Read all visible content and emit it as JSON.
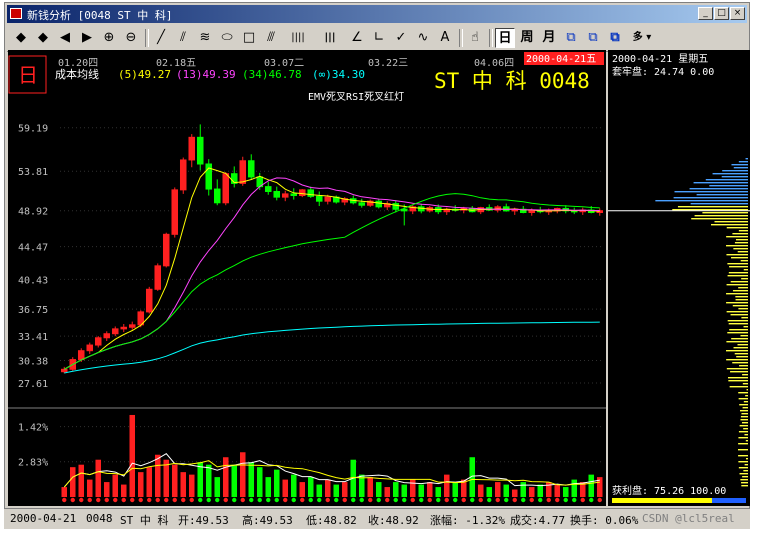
{
  "window": {
    "title": "新钱分析 [0048 ST 中 科]",
    "min": "_",
    "max": "□",
    "close": "×"
  },
  "toolbar": {
    "buttons": [
      {
        "name": "up-arrow-icon",
        "glyph": "◆"
      },
      {
        "name": "down-arrow-icon",
        "glyph": "◆"
      },
      {
        "name": "left-arrow-icon",
        "glyph": "◀"
      },
      {
        "name": "right-arrow-icon",
        "glyph": "▶"
      },
      {
        "name": "zoom-in-icon",
        "glyph": "⊕"
      },
      {
        "name": "zoom-out-icon",
        "glyph": "⊖"
      },
      {
        "name": "sep"
      },
      {
        "name": "line-tool-icon",
        "glyph": "╱"
      },
      {
        "name": "parallel-line-icon",
        "glyph": "⫽"
      },
      {
        "name": "fib-fan-icon",
        "glyph": "≋"
      },
      {
        "name": "ellipse-tool-icon",
        "glyph": "⬭"
      },
      {
        "name": "rect-tool-icon",
        "glyph": "□"
      },
      {
        "name": "channel-tool-icon",
        "glyph": "⫻"
      },
      {
        "name": "bars-tool-icon",
        "glyph": "||||"
      },
      {
        "name": "period-lines-icon",
        "glyph": "|||"
      },
      {
        "name": "angle-tool-icon",
        "glyph": "∠"
      },
      {
        "name": "speed-line-icon",
        "glyph": "∟"
      },
      {
        "name": "check-tool-icon",
        "glyph": "✓"
      },
      {
        "name": "wave-tool-icon",
        "glyph": "∿"
      },
      {
        "name": "text-tool-icon",
        "glyph": "A"
      },
      {
        "name": "sep"
      },
      {
        "name": "pointer-icon",
        "glyph": "☝"
      },
      {
        "name": "sep"
      },
      {
        "name": "period-day",
        "glyph": "日"
      },
      {
        "name": "period-week",
        "glyph": "周"
      },
      {
        "name": "period-month",
        "glyph": "月"
      },
      {
        "name": "window-tile-icon",
        "glyph": "⧉"
      },
      {
        "name": "window-cascade-icon",
        "glyph": "⧉"
      },
      {
        "name": "window-multi-icon",
        "glyph": "⧉"
      },
      {
        "name": "multi-dropdown",
        "glyph": "多 ▾"
      }
    ]
  },
  "chart": {
    "period_badge": "日",
    "ma_title": "成本均线",
    "ma_values": [
      {
        "label": "(5)49.27",
        "color": "#ffff00"
      },
      {
        "label": "(13)49.39",
        "color": "#ff44ff"
      },
      {
        "label": "(34)46.78",
        "color": "#00ff00"
      },
      {
        "label": "(∞)34.30",
        "color": "#00ffff"
      }
    ],
    "signal_text": "EMV死叉RSI死叉红灯",
    "stock_title": "ST 中 科 0048",
    "current_date_badge": "2000-04-21五",
    "date_labels": [
      "01.20四",
      "02.18五",
      "03.07二",
      "03.22三",
      "04.06四"
    ],
    "price_ticks": [
      "59.19",
      "53.81",
      "48.92",
      "44.47",
      "40.43",
      "36.75",
      "33.41",
      "30.38",
      "27.61"
    ],
    "volume_ticks": [
      "2.83%",
      "1.42%"
    ]
  },
  "chart_data": {
    "type": "candlestick",
    "title": "ST 中 科 0048",
    "ylabel": "",
    "ylim": [
      25.5,
      62
    ],
    "candles": [
      [
        29.0,
        29.6,
        28.8,
        29.3
      ],
      [
        29.3,
        30.8,
        29.1,
        30.5
      ],
      [
        30.5,
        31.9,
        30.2,
        31.6
      ],
      [
        31.6,
        32.6,
        31.2,
        32.3
      ],
      [
        32.3,
        33.4,
        32.0,
        33.2
      ],
      [
        33.2,
        34.0,
        32.8,
        33.7
      ],
      [
        33.7,
        34.6,
        33.4,
        34.3
      ],
      [
        34.3,
        34.9,
        33.9,
        34.5
      ],
      [
        34.5,
        35.2,
        34.2,
        34.8
      ],
      [
        34.8,
        36.6,
        34.5,
        36.4
      ],
      [
        36.4,
        39.5,
        36.2,
        39.2
      ],
      [
        39.2,
        42.4,
        39.0,
        42.1
      ],
      [
        42.1,
        46.2,
        41.9,
        46.0
      ],
      [
        46.0,
        51.8,
        45.6,
        51.5
      ],
      [
        51.5,
        55.5,
        51.0,
        55.2
      ],
      [
        55.2,
        58.4,
        54.3,
        58.0
      ],
      [
        58.0,
        59.6,
        53.9,
        54.7
      ],
      [
        54.7,
        55.3,
        50.8,
        51.6
      ],
      [
        51.6,
        52.8,
        49.6,
        49.9
      ],
      [
        49.9,
        53.7,
        49.6,
        53.5
      ],
      [
        53.5,
        54.4,
        51.8,
        52.3
      ],
      [
        52.3,
        55.6,
        52.0,
        55.1
      ],
      [
        55.1,
        55.9,
        52.8,
        53.1
      ],
      [
        53.1,
        53.6,
        51.5,
        51.9
      ],
      [
        51.9,
        52.5,
        50.9,
        51.3
      ],
      [
        51.3,
        51.9,
        50.2,
        50.6
      ],
      [
        50.6,
        51.4,
        50.1,
        51.0
      ],
      [
        51.0,
        51.7,
        50.3,
        50.8
      ],
      [
        50.8,
        51.6,
        50.6,
        51.5
      ],
      [
        51.5,
        51.9,
        50.5,
        50.7
      ],
      [
        50.7,
        51.3,
        49.5,
        50.1
      ],
      [
        50.1,
        50.9,
        49.7,
        50.6
      ],
      [
        50.6,
        50.8,
        49.8,
        50.0
      ],
      [
        50.0,
        50.6,
        49.6,
        50.4
      ],
      [
        50.4,
        50.8,
        49.7,
        49.9
      ],
      [
        49.9,
        50.4,
        49.3,
        49.6
      ],
      [
        49.6,
        50.3,
        49.4,
        50.1
      ],
      [
        50.1,
        50.4,
        49.2,
        49.4
      ],
      [
        49.4,
        50.1,
        49.0,
        49.8
      ],
      [
        49.8,
        50.2,
        48.7,
        49.1
      ],
      [
        49.1,
        49.7,
        47.1,
        48.9
      ],
      [
        48.9,
        49.6,
        48.5,
        49.4
      ],
      [
        49.4,
        49.8,
        48.6,
        48.9
      ],
      [
        48.9,
        49.5,
        48.7,
        49.3
      ],
      [
        49.3,
        49.7,
        48.5,
        48.8
      ],
      [
        48.8,
        49.3,
        48.4,
        49.1
      ],
      [
        49.1,
        49.6,
        48.8,
        49.0
      ],
      [
        49.0,
        49.4,
        48.6,
        49.2
      ],
      [
        49.2,
        49.5,
        48.7,
        48.8
      ],
      [
        48.8,
        49.4,
        48.5,
        49.3
      ],
      [
        49.3,
        49.7,
        48.9,
        49.0
      ],
      [
        49.0,
        49.6,
        48.7,
        49.4
      ],
      [
        49.4,
        49.8,
        48.8,
        48.9
      ],
      [
        48.9,
        49.3,
        48.4,
        49.1
      ],
      [
        49.1,
        49.5,
        48.6,
        48.7
      ],
      [
        48.7,
        49.2,
        48.3,
        49.0
      ],
      [
        49.0,
        49.4,
        48.6,
        48.8
      ],
      [
        48.8,
        49.2,
        48.4,
        48.9
      ],
      [
        48.9,
        49.3,
        48.6,
        49.2
      ],
      [
        49.2,
        49.6,
        48.6,
        48.9
      ],
      [
        48.9,
        49.3,
        48.5,
        48.8
      ],
      [
        48.8,
        49.3,
        48.4,
        49.0
      ],
      [
        49.0,
        49.5,
        48.6,
        48.7
      ],
      [
        48.7,
        49.2,
        48.3,
        48.92
      ]
    ],
    "volume_ticks": [
      1.42,
      2.83
    ],
    "volume": [
      0.4,
      1.2,
      1.3,
      0.7,
      1.5,
      0.6,
      0.9,
      0.5,
      3.3,
      1.0,
      1.2,
      1.7,
      1.5,
      1.3,
      1.0,
      0.9,
      1.4,
      1.3,
      0.8,
      1.6,
      1.3,
      1.8,
      1.4,
      1.2,
      0.8,
      1.1,
      0.7,
      0.9,
      0.6,
      0.8,
      0.5,
      0.7,
      0.5,
      0.6,
      1.5,
      0.9,
      0.8,
      0.6,
      0.4,
      0.6,
      0.5,
      0.7,
      0.5,
      0.6,
      0.4,
      0.9,
      0.6,
      0.7,
      1.6,
      0.5,
      0.4,
      0.6,
      0.5,
      0.3,
      0.6,
      0.4,
      0.5,
      0.6,
      0.5,
      0.4,
      0.7,
      0.6,
      0.9,
      0.8
    ],
    "series_ma": [
      {
        "name": "5",
        "color": "#ffff00"
      },
      {
        "name": "13",
        "color": "#ff44ff"
      },
      {
        "name": "34",
        "color": "#00ff00"
      },
      {
        "name": "∞",
        "color": "#00ffff"
      }
    ],
    "up_color": "#ff2020",
    "down_color": "#00ff00"
  },
  "right_panel": {
    "date_line": "2000-04-21 星期五",
    "lock_line": "套牢盘: 24.74 0.00",
    "profit_line": "获利盘: 75.26 100.00"
  },
  "status": {
    "date": "2000-04-21",
    "code": "0048",
    "name": "ST 中 科",
    "open": "开:49.53",
    "high": "高:49.53",
    "low": "低:48.82",
    "close": "收:48.92",
    "change": "涨幅: -1.32%",
    "volume": "成交:4.77",
    "turnover": "换手: 0.06%",
    "watermark": "CSDN @lcl5real"
  }
}
